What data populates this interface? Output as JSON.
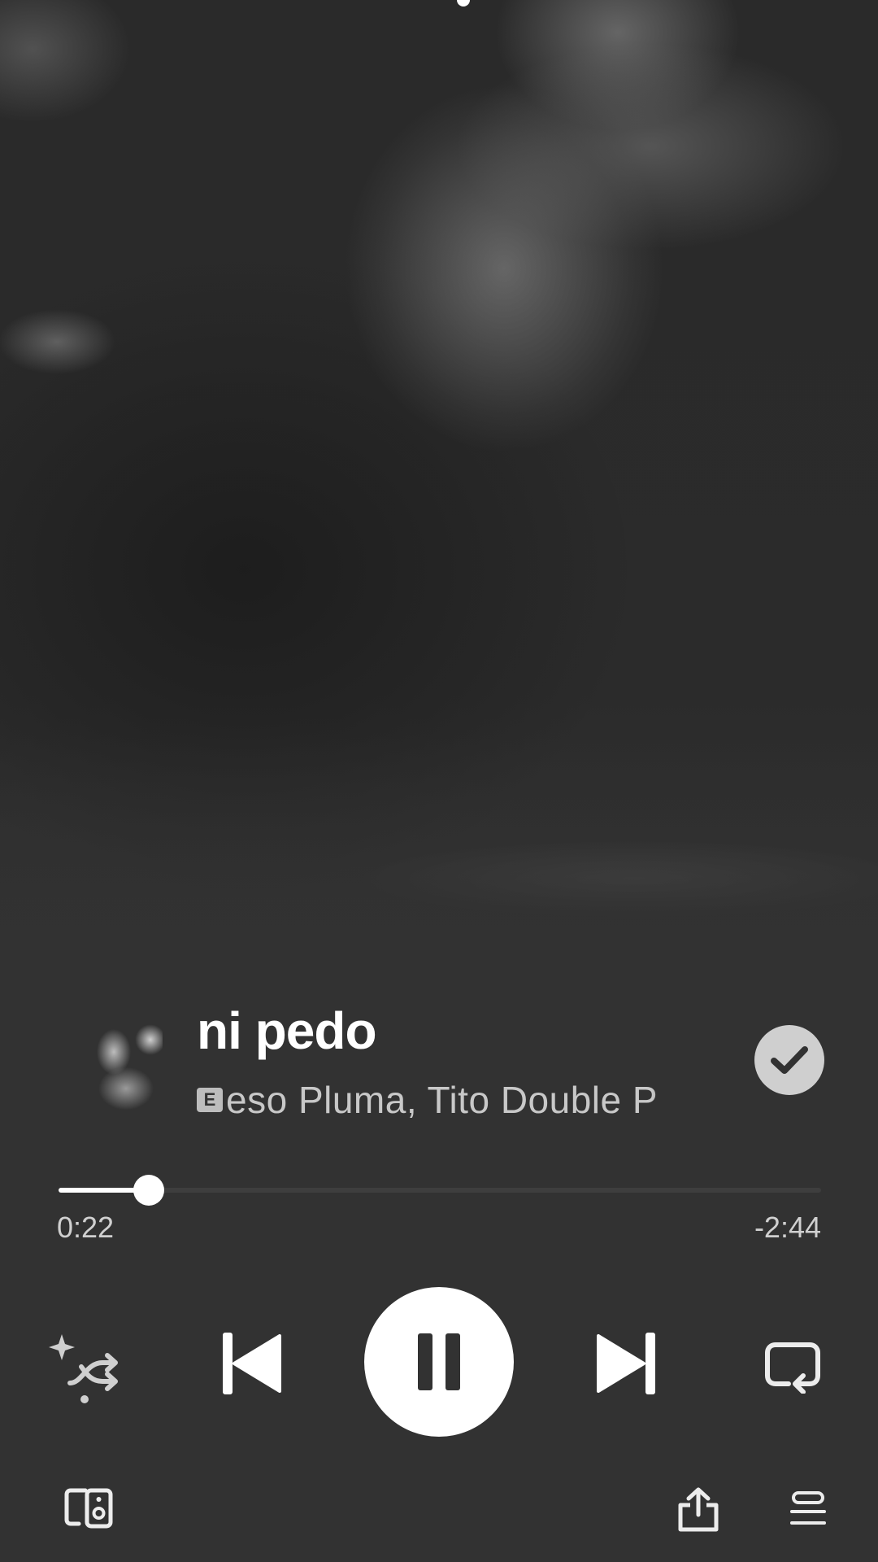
{
  "track": {
    "title": "ni pedo",
    "explicit_badge": "E",
    "artists": "Peso Pluma, Tito Double P",
    "artists_visible": "eso Pluma, Tito Double P",
    "saved": true
  },
  "playback": {
    "elapsed": "0:22",
    "remaining": "-2:44",
    "progress_fraction": 0.118,
    "is_playing": true
  },
  "icons": {
    "saved": "check-circle-icon",
    "shuffle": "smart-shuffle-icon",
    "previous": "skip-previous-icon",
    "play_pause": "pause-icon",
    "next": "skip-next-icon",
    "repeat": "repeat-icon",
    "devices": "connect-device-icon",
    "share": "share-icon",
    "queue": "queue-icon"
  },
  "colors": {
    "background": "#323232",
    "accent": "#ffffff",
    "secondary_text": "#c8c8c8"
  }
}
